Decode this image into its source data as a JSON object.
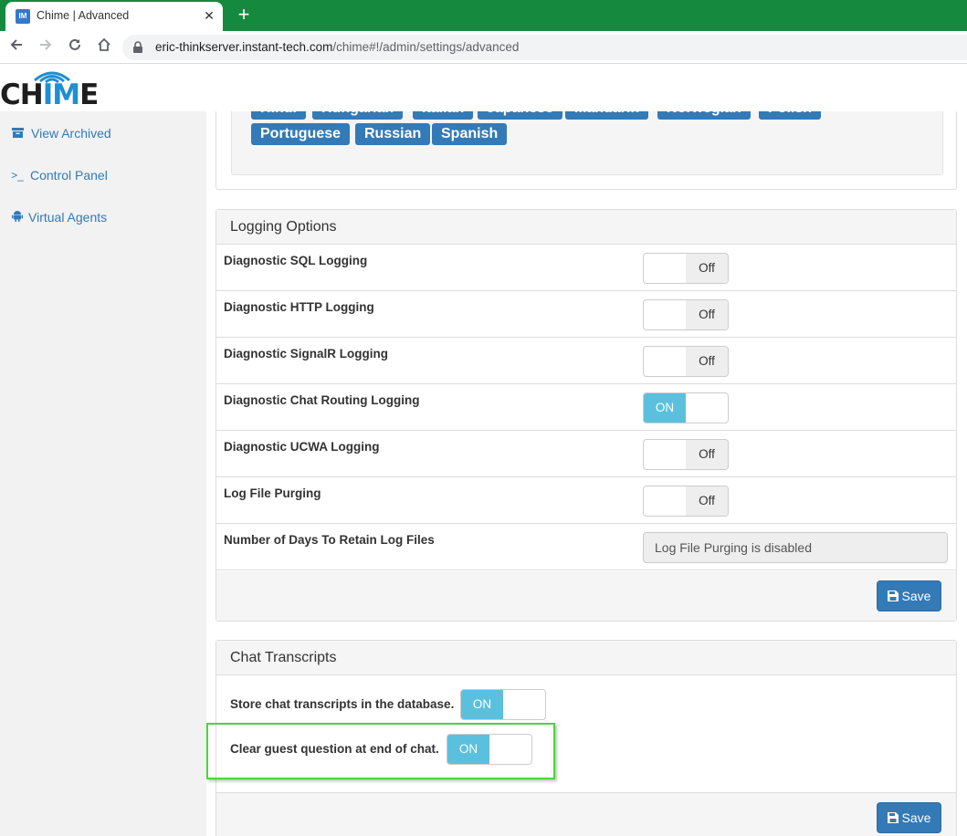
{
  "browser": {
    "tab_title": "Chime | Advanced",
    "tab_close": "✕",
    "new_tab": "+",
    "url_host": "eric-thinkserver.instant-tech.com",
    "url_path": "/chime#!/admin/settings/advanced"
  },
  "app": {
    "logo_prefix": "CH",
    "logo_accent": "IM",
    "logo_suffix": "E",
    "accent_color": "#1e8fd3"
  },
  "sidebar": {
    "items": [
      {
        "label": "View Archived",
        "icon": "archive-icon"
      },
      {
        "label": "Control Panel",
        "icon": "terminal-icon",
        "glyph": ">_"
      },
      {
        "label": "Virtual Agents",
        "icon": "android-icon"
      }
    ]
  },
  "languages": {
    "tags": [
      "Hindi",
      "Hungarian",
      "Italian",
      "Japanese",
      "Mandarin",
      "Norwegian",
      "Polish",
      "Portuguese",
      "Russian",
      "Spanish"
    ]
  },
  "logging": {
    "title": "Logging Options",
    "rows": [
      {
        "label": "Diagnostic SQL Logging",
        "state": "Off"
      },
      {
        "label": "Diagnostic HTTP Logging",
        "state": "Off"
      },
      {
        "label": "Diagnostic SignalR Logging",
        "state": "Off"
      },
      {
        "label": "Diagnostic Chat Routing Logging",
        "state": "ON"
      },
      {
        "label": "Diagnostic UCWA Logging",
        "state": "Off"
      },
      {
        "label": "Log File Purging",
        "state": "Off"
      },
      {
        "label": "Number of Days To Retain Log Files",
        "value": "Log File Purging is disabled"
      }
    ],
    "save_label": "Save"
  },
  "transcripts": {
    "title": "Chat Transcripts",
    "store_label": "Store chat transcripts in the database.",
    "store_state": "ON",
    "clear_label": "Clear guest question at end of chat.",
    "clear_state": "ON",
    "save_label": "Save"
  }
}
